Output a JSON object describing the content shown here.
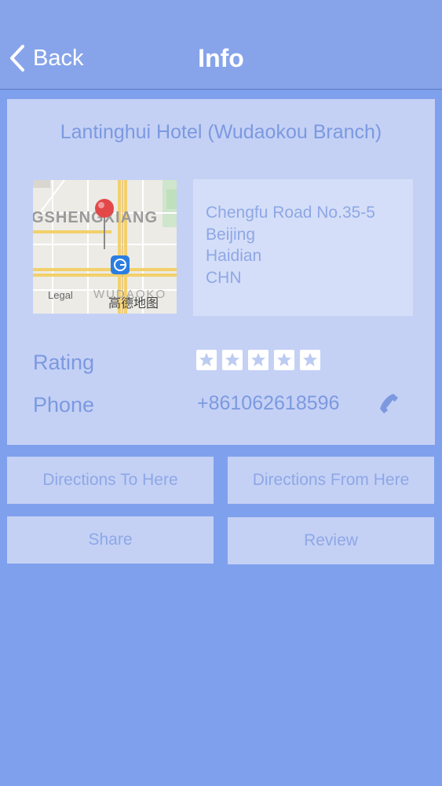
{
  "nav": {
    "back_label": "Back",
    "title": "Info"
  },
  "hotel": {
    "name": "Lantinghui Hotel (Wudaokou Branch)",
    "address": [
      "Chengfu Road No.35-5",
      "Beijing",
      "Haidian",
      "CHN"
    ],
    "rating_label": "Rating",
    "rating_stars": 5,
    "phone_label": "Phone",
    "phone": "+861062618596"
  },
  "map": {
    "street_label": "GSHENGXIANG",
    "area_label": "WUDAOKO",
    "legal_label": "Legal",
    "provider_label": "高德地图",
    "metro_glyph": "G"
  },
  "actions": {
    "directions_to": "Directions To Here",
    "directions_from": "Directions From Here",
    "share": "Share",
    "review": "Review"
  },
  "colors": {
    "background": "#7fa0ec",
    "card": "#c4d1f5",
    "accent_text": "#7c99e0"
  }
}
